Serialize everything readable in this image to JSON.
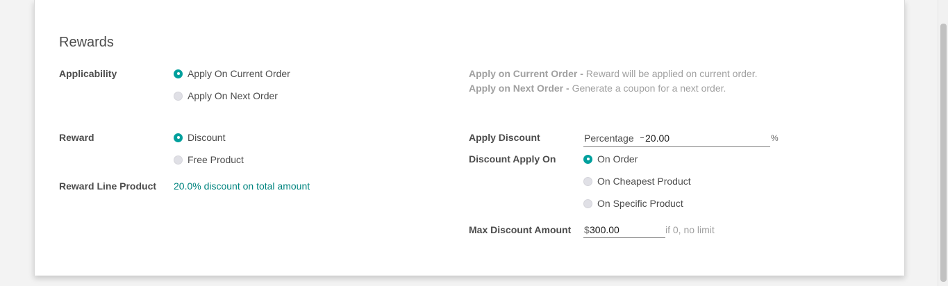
{
  "section": {
    "title": "Rewards"
  },
  "applicability": {
    "label": "Applicability",
    "options": [
      {
        "label": "Apply On Current Order",
        "selected": true
      },
      {
        "label": "Apply On Next Order",
        "selected": false
      }
    ],
    "help": [
      {
        "term": "Apply on Current Order -",
        "text": "Reward will be applied on current order."
      },
      {
        "term": "Apply on Next Order -",
        "text": "Generate a coupon for a next order."
      }
    ]
  },
  "reward": {
    "label": "Reward",
    "options": [
      {
        "label": "Discount",
        "selected": true
      },
      {
        "label": "Free Product",
        "selected": false
      }
    ]
  },
  "reward_line_product": {
    "label": "Reward Line Product",
    "value": "20.0% discount on total amount"
  },
  "apply_discount": {
    "label": "Apply Discount",
    "type_value": "Percentage",
    "amount_value": "20.00",
    "unit": "%"
  },
  "discount_apply_on": {
    "label": "Discount Apply On",
    "options": [
      {
        "label": "On Order",
        "selected": true
      },
      {
        "label": "On Cheapest Product",
        "selected": false
      },
      {
        "label": "On Specific Product",
        "selected": false
      }
    ]
  },
  "max_discount": {
    "label": "Max Discount Amount",
    "currency": "$",
    "value": "300.00",
    "hint": "if 0, no limit"
  },
  "colors": {
    "accent": "#00a09d",
    "link": "#00847f",
    "help_text": "#a0a0a0"
  }
}
